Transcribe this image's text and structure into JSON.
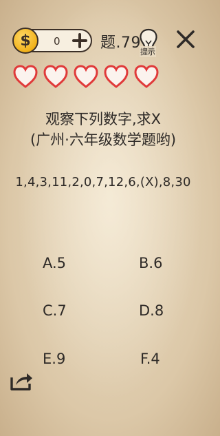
{
  "header": {
    "coins": "0",
    "coin_symbol": "$",
    "level": "题.79",
    "hint_label": "提示"
  },
  "hearts": {
    "count": 5,
    "color": "#e03a3a"
  },
  "question": {
    "line1": "观察下列数字,求X",
    "line2": "(广州·六年级数学题哟)",
    "sequence": "1,4,3,11,2,0,7,12,6,(X),8,30"
  },
  "options": [
    "A.5",
    "B.6",
    "C.7",
    "D.8",
    "E.9",
    "F.4"
  ],
  "colors": {
    "accent_coin": "#f2b21a",
    "ink": "#2e2a27",
    "paper": "#e9dbc2"
  }
}
